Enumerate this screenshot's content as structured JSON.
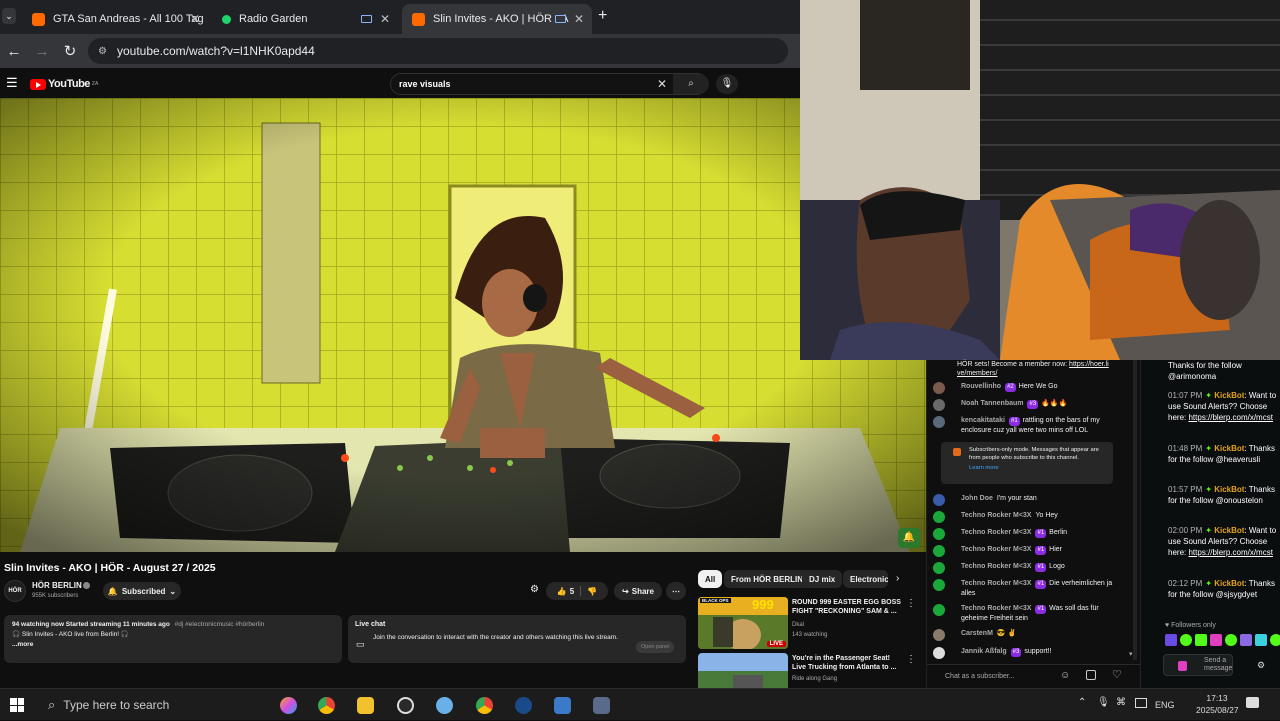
{
  "browser": {
    "tabs": [
      {
        "label": "GTA San Andreas - All 100 Tag"
      },
      {
        "label": "Radio Garden"
      },
      {
        "label": "Slin Invites - AKO | HÖR - A"
      }
    ],
    "url": "youtube.com/watch?v=l1NHK0apd44"
  },
  "youtube": {
    "logo": "YouTube",
    "logo_sup": "ZA",
    "search_value": "rave visuals",
    "video_title": "Slin Invites - AKO | HÖR - August 27 / 2025",
    "channel_name": "HÖR BERLIN",
    "channel_avatar": "HÖR",
    "subscribers": "955K subscribers",
    "subscribed_label": "Subscribed",
    "likes": "5",
    "share_label": "Share",
    "desc_line1": "94 watching now  Started streaming 11 minutes ago",
    "desc_tags": "#dj #electronicmusic #hörberlin",
    "desc_line2": "🎧 Slin Invites - AKO live from Berlin! 🎧",
    "desc_more": "...more",
    "livechat_title": "Live chat",
    "livechat_text": "Join the conversation to interact with the creator and others watching this live stream.",
    "livechat_btn": "Open panel",
    "chips": [
      "All",
      "From HÖR BERLIN",
      "DJ mix",
      "Electronic"
    ],
    "recs": [
      {
        "title": "ROUND 999 EASTER EGG BOSS FIGHT \"RECKONING\" SAM & ...",
        "channel": "Dkal",
        "meta": "143 watching",
        "badge": "LIVE",
        "thumb_text": "999",
        "thumb_label": "BLACK OPS"
      },
      {
        "title": "You're in the Passenger Seat! Live Trucking from Atlanta to ...",
        "channel": "Ride along Gang",
        "meta": ""
      }
    ]
  },
  "ytchat": {
    "top_text": "HÖR sets! Become a member now:",
    "top_link": "https://hoer.li ve/members/",
    "messages": [
      {
        "author": "Rouvellinho",
        "badge": "#2",
        "text": "Here We Go"
      },
      {
        "author": "Noah Tannenbaum",
        "badge": "#3",
        "text": "🔥🔥🔥"
      },
      {
        "author": "kencakitataki",
        "badge": "#1",
        "text": "rattling on the bars of my enclosure cuz yall were two mins off LOL"
      }
    ],
    "subs_notice": "Subscribers-only mode. Messages that appear are from people who subscribe to this channel.",
    "learn_more": "Learn more",
    "messages2": [
      {
        "author": "John Doe",
        "badge": "",
        "text": "I'm your stan"
      },
      {
        "author": "Techno Rocker M<3X",
        "badge": "",
        "text": "Yo Hey"
      },
      {
        "author": "Techno Rocker M<3X",
        "badge": "#1",
        "text": "Berlin"
      },
      {
        "author": "Techno Rocker M<3X",
        "badge": "#1",
        "text": "Hier"
      },
      {
        "author": "Techno Rocker M<3X",
        "badge": "#1",
        "text": "Logo"
      },
      {
        "author": "Techno Rocker M<3X",
        "badge": "#1",
        "text": "Die verheimlichen ja alles"
      },
      {
        "author": "Techno Rocker M<3X",
        "badge": "#1",
        "text": "Was soll das für geheime Freiheit sein"
      },
      {
        "author": "CarstenM",
        "badge": "",
        "text": "😎 ✌"
      },
      {
        "author": "Jannik Aßfalg",
        "badge": "#3",
        "text": "support!!"
      }
    ],
    "input_placeholder": "Chat as a subscriber..."
  },
  "kick": {
    "top_text": "Thanks for the follow @arimonoma",
    "messages": [
      {
        "time": "01:07 PM",
        "bot": "KickBot",
        "text": "Want to use Sound Alerts?? Choose here:",
        "link": "https://blerp.com/x/mcst"
      },
      {
        "time": "01:48 PM",
        "bot": "KickBot",
        "text": "Thanks for the follow @heaverusli",
        "link": ""
      },
      {
        "time": "01:57 PM",
        "bot": "KickBot",
        "text": "Thanks for the follow @onoustelon",
        "link": ""
      },
      {
        "time": "02:00 PM",
        "bot": "KickBot",
        "text": "Want to use Sound Alerts?? Choose here:",
        "link": "https://blerp.com/x/mcst"
      },
      {
        "time": "02:12 PM",
        "bot": "KickBot",
        "text": "Thanks for the follow @sjsygdyet",
        "link": ""
      }
    ],
    "followers_only": "Followers only",
    "send_placeholder": "Send a message"
  },
  "taskbar": {
    "search_placeholder": "Type here to search",
    "lang": "ENG",
    "time": "17:13",
    "date": "2025/08/27"
  },
  "colors": {
    "youtube_red": "#ff0000",
    "kick_green": "#53fc18",
    "member_purple": "#8b2be2",
    "kickbot_gold": "#e3a21a"
  }
}
